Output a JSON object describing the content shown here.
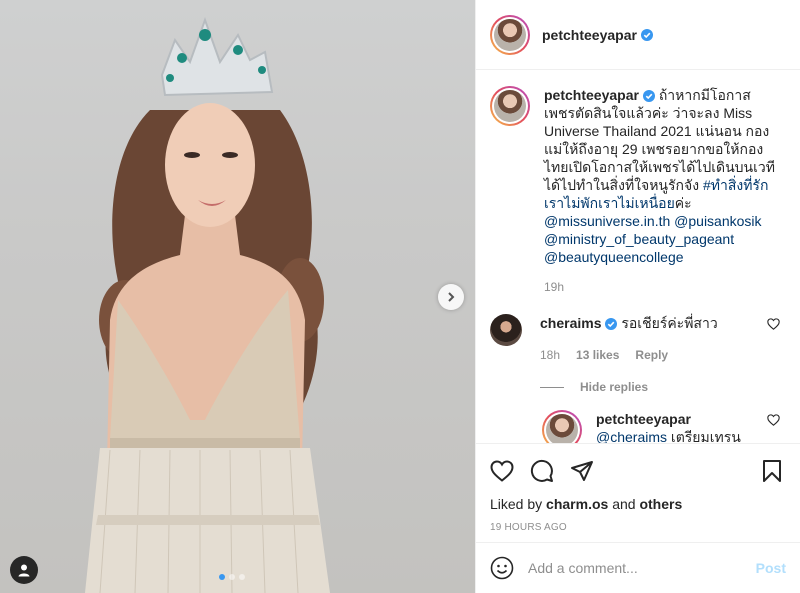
{
  "post": {
    "author": "petchteeyapar",
    "caption": {
      "text": "ถ้าหากมีโอกาส เพชรตัดสินใจแล้วค่ะ ว่าจะลง Miss Universe Thailand 2021 แน่นอน กองแม่ให้ถึงอายุ 29 เพชรอยากขอให้กองไทยเปิดโอกาสให้เพชรได้ไปเดินบนเวที ได้ไปทำในสิ่งที่ใจหนูรักจัง",
      "hashtag": "#ทำสิ่งที่รักเราไม่พักเราไม่เหนื่อย",
      "after_hashtag": "ค่ะ",
      "mentions": [
        "@missuniverse.in.th",
        "@puisankosik",
        "@ministry_of_beauty_pageant",
        "@beautyqueencollege"
      ],
      "time": "19h"
    },
    "comments": [
      {
        "author": "cheraims",
        "text": "รอเชียร์ค่ะพี่สาว",
        "time": "18h",
        "likes": "13 likes",
        "reply_label": "Reply",
        "hide_replies_label": "Hide replies",
        "replies": [
          {
            "author": "petchteeyapar",
            "mention": "@cheraims",
            "text": "เตรียมเทรน"
          }
        ]
      }
    ],
    "liked_by": {
      "prefix": "Liked by",
      "user": "charm.os",
      "joiner": "and",
      "others": "others"
    },
    "time_ago": "19 HOURS AGO"
  },
  "comment_box": {
    "placeholder": "Add a comment...",
    "post_label": "Post"
  },
  "carousel": {
    "slide_count": 3,
    "active_index": 0
  },
  "colors": {
    "verified": "#3897f0",
    "link": "#00376b",
    "muted": "#8e8e8e",
    "post_button": "#b2dffc"
  },
  "icons": {
    "like": "heart-icon",
    "comment": "comment-icon",
    "share": "paper-plane-icon",
    "save": "bookmark-icon",
    "emoji": "smiley-icon",
    "next": "chevron-right-icon",
    "user_tag": "user-icon"
  }
}
